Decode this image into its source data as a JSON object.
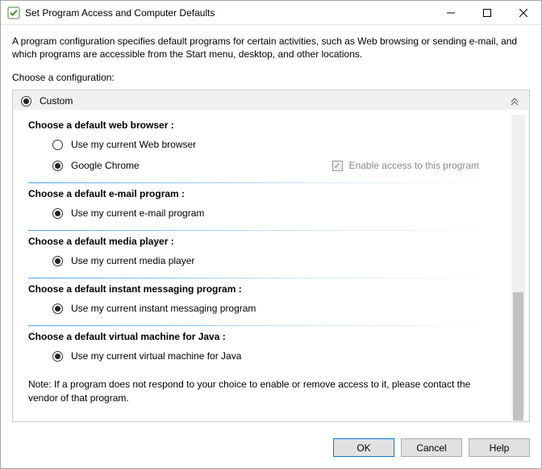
{
  "window": {
    "title": "Set Program Access and Computer Defaults"
  },
  "intro": "A program configuration specifies default programs for certain activities, such as Web browsing or sending e-mail, and which programs are accessible from the Start menu, desktop, and other locations.",
  "choose_label": "Choose a configuration:",
  "config": {
    "label": "Custom"
  },
  "sections": {
    "browser": {
      "title": "Choose a default web browser :",
      "opt_current": "Use my current Web browser",
      "opt_chrome": "Google Chrome",
      "enable_label": "Enable access to this program"
    },
    "email": {
      "title": "Choose a default e-mail program :",
      "opt_current": "Use my current e-mail program"
    },
    "media": {
      "title": "Choose a default media player :",
      "opt_current": "Use my current media player"
    },
    "im": {
      "title": "Choose a default instant messaging program :",
      "opt_current": "Use my current instant messaging program"
    },
    "java": {
      "title": "Choose a default virtual machine for Java :",
      "opt_current": "Use my current virtual machine for Java"
    }
  },
  "note": "Note: If a program does not respond to your choice to enable or remove access to it, please contact the vendor of that program.",
  "buttons": {
    "ok": "OK",
    "cancel": "Cancel",
    "help": "Help"
  }
}
